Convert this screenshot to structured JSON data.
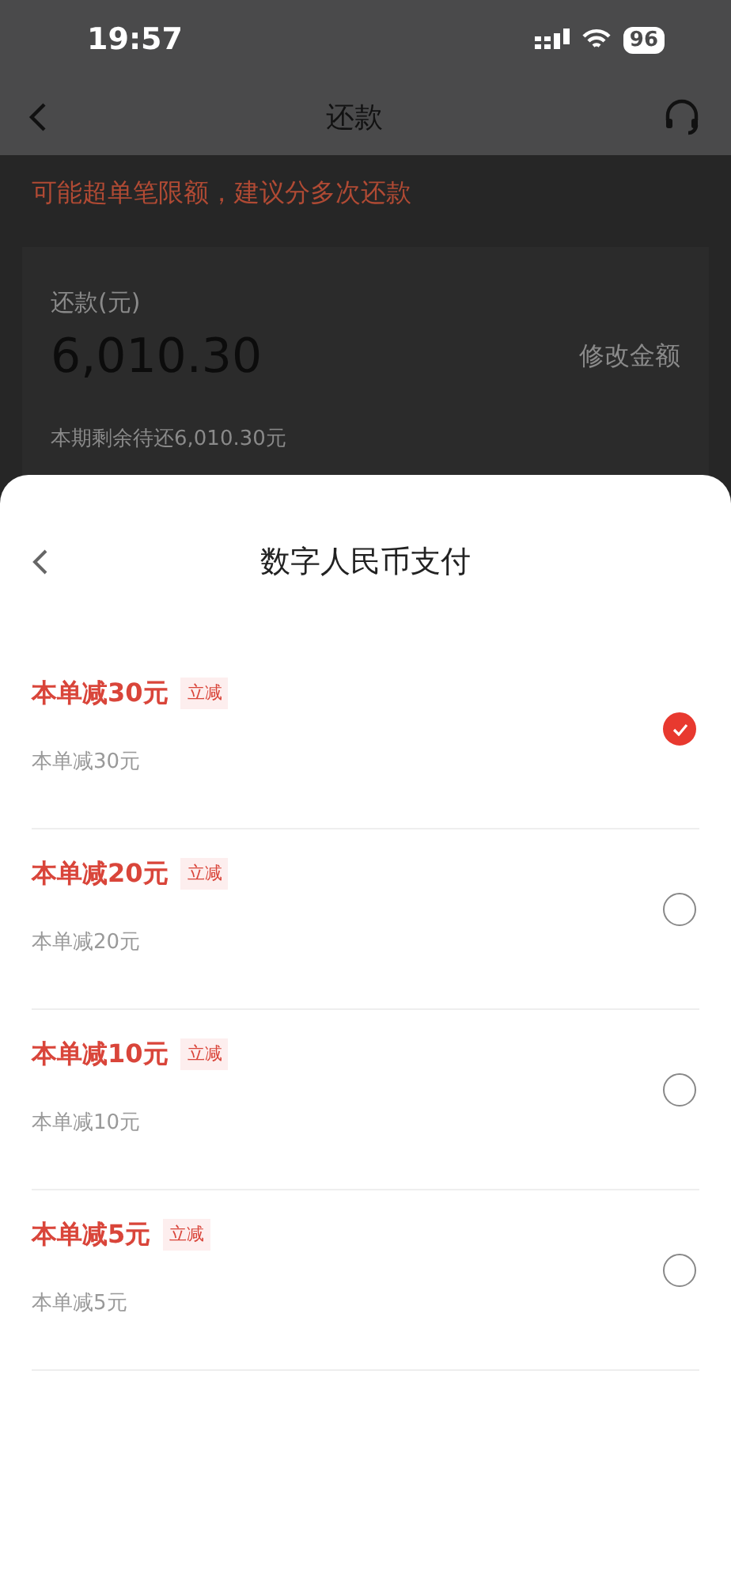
{
  "status_bar": {
    "time": "19:57",
    "battery": "96"
  },
  "nav": {
    "title": "还款"
  },
  "warning": "可能超单笔限额，建议分多次还款",
  "repay_card": {
    "label": "还款(元)",
    "amount": "6,010.30",
    "edit_link": "修改金额",
    "remaining": "本期剩余待还6,010.30元"
  },
  "sheet": {
    "title": "数字人民币支付",
    "options": [
      {
        "title": "本单减30元",
        "tag": "立减",
        "detail": "本单减30元",
        "selected": true
      },
      {
        "title": "本单减20元",
        "tag": "立减",
        "detail": "本单减20元",
        "selected": false
      },
      {
        "title": "本单减10元",
        "tag": "立减",
        "detail": "本单减10元",
        "selected": false
      },
      {
        "title": "本单减5元",
        "tag": "立减",
        "detail": "本单减5元",
        "selected": false
      }
    ]
  }
}
